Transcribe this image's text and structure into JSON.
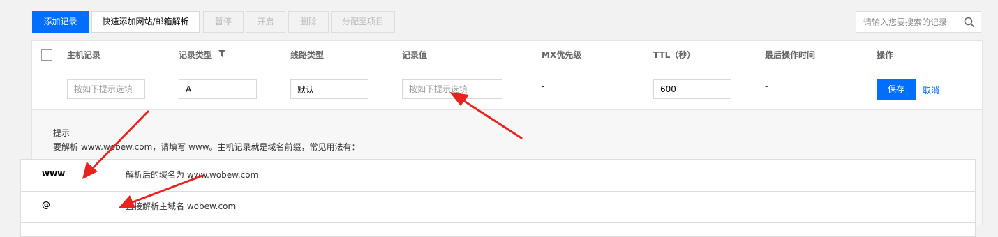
{
  "toolbar": {
    "add_record": "添加记录",
    "quick_add": "快速添加网站/邮箱解析",
    "pause": "暂停",
    "enable": "开启",
    "delete": "删除",
    "assign_project": "分配至项目"
  },
  "search": {
    "placeholder": "请输入您要搜索的记录"
  },
  "table": {
    "headers": {
      "host": "主机记录",
      "type": "记录类型",
      "line": "线路类型",
      "value": "记录值",
      "mx": "MX优先级",
      "ttl": "TTL（秒）",
      "last_op": "最后操作时间",
      "action": "操作"
    },
    "edit_row": {
      "host_placeholder": "按如下提示选填",
      "type_value": "A",
      "line_value": "默认",
      "value_placeholder": "按如下提示选填",
      "mx": "-",
      "ttl_value": "600",
      "last_op": "-",
      "save": "保存",
      "cancel": "取消"
    }
  },
  "hint": {
    "title": "提示",
    "description": "要解析 www.wobew.com，请填写 www。主机记录就是域名前缀，常见用法有：",
    "rows": [
      {
        "key": "www",
        "desc": "解析后的域名为 www.wobew.com"
      },
      {
        "key": "@",
        "desc": "直接解析主域名 wobew.com"
      }
    ]
  },
  "colors": {
    "primary": "#006eff",
    "annotation_arrow": "#e8231e"
  }
}
